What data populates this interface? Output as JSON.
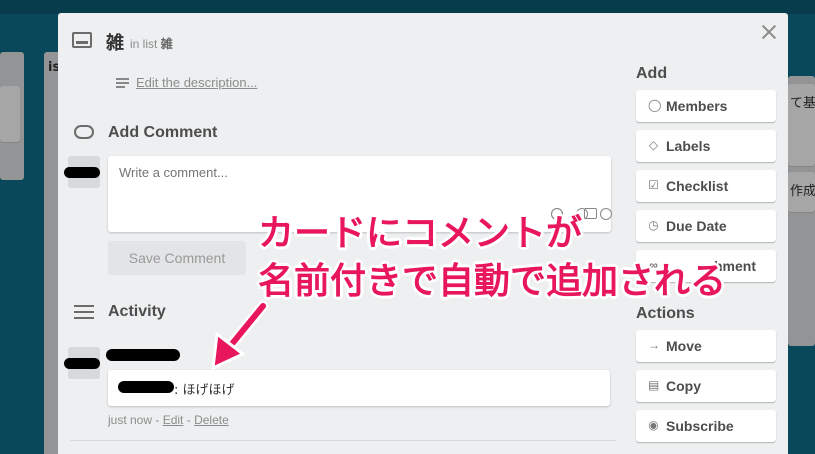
{
  "card": {
    "title": "雑",
    "in_list_prefix": "in list",
    "list_name": "雑",
    "description_link": "Edit the description..."
  },
  "comment_section": {
    "heading": "Add Comment",
    "placeholder": "Write a comment...",
    "save_label": "Save Comment"
  },
  "activity": {
    "heading": "Activity",
    "comment_text": ": ほげほげ",
    "time": "just now",
    "separator": " - ",
    "edit_label": "Edit",
    "delete_label": "Delete"
  },
  "sidebar": {
    "add_heading": "Add",
    "add_items": [
      {
        "label": "Members",
        "icon": "person-icon"
      },
      {
        "label": "Labels",
        "icon": "tag-icon"
      },
      {
        "label": "Checklist",
        "icon": "checkbox-icon"
      },
      {
        "label": "Due Date",
        "icon": "clock-icon"
      },
      {
        "label": "hment",
        "icon": "paperclip-icon"
      }
    ],
    "actions_heading": "Actions",
    "action_items": [
      {
        "label": "Move",
        "icon": "arrow-right-icon"
      },
      {
        "label": "Copy",
        "icon": "card-icon"
      },
      {
        "label": "Subscribe",
        "icon": "eye-icon"
      }
    ]
  },
  "annotation": {
    "line1": "カードにコメントが",
    "line2": "名前付きで自動で追加される",
    "color": "#e8175d"
  },
  "background": {
    "left_list_title": "is",
    "right_text_1": "て基本",
    "right_text_2": "作成"
  }
}
